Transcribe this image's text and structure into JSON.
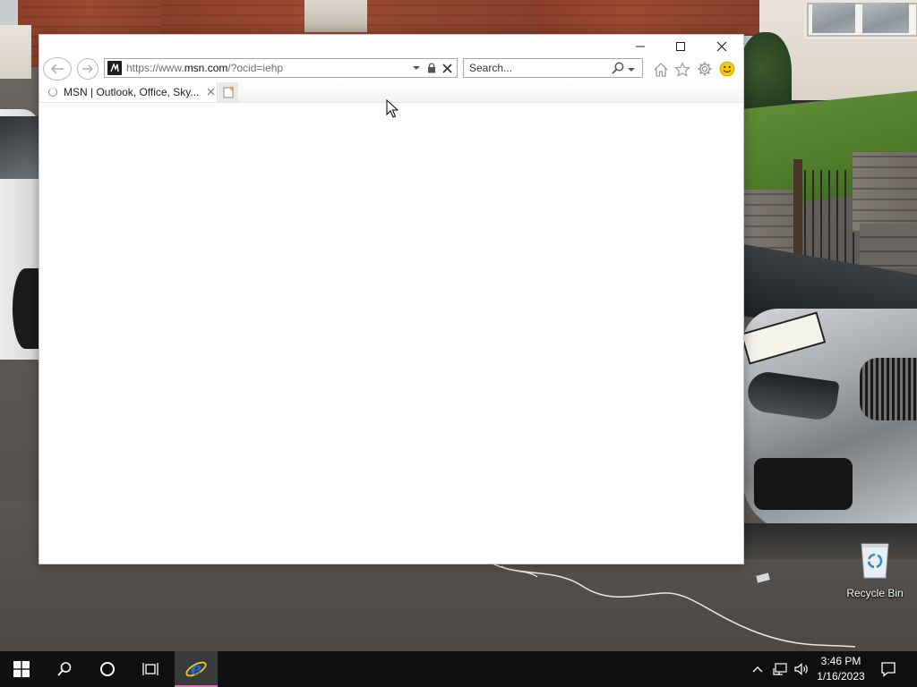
{
  "browser": {
    "window_controls": {
      "minimize": "minimize",
      "maximize": "maximize",
      "close": "close"
    },
    "address_bar": {
      "scheme": "https://www.",
      "host": "msn.com",
      "path": "/?ocid=iehp"
    },
    "search": {
      "placeholder": "Search..."
    },
    "tabs": [
      {
        "label": "MSN | Outlook, Office, Sky...",
        "loading": true
      }
    ],
    "toolbar_icons": [
      "home-icon",
      "favorites-star-icon",
      "tools-gear-icon",
      "feedback-smiley-icon"
    ]
  },
  "desktop": {
    "recycle_bin_label": "Recycle Bin"
  },
  "taskbar": {
    "clock_time": "3:46 PM",
    "clock_date": "1/16/2023",
    "pinned": [
      "start",
      "search",
      "cortana",
      "task-view",
      "internet-explorer"
    ],
    "accent_color": "#e26fb2"
  },
  "colors": {
    "ie_blue": "#1e6fc8",
    "taskbar_bg": "#101010",
    "smiley_yellow": "#f2c811"
  }
}
